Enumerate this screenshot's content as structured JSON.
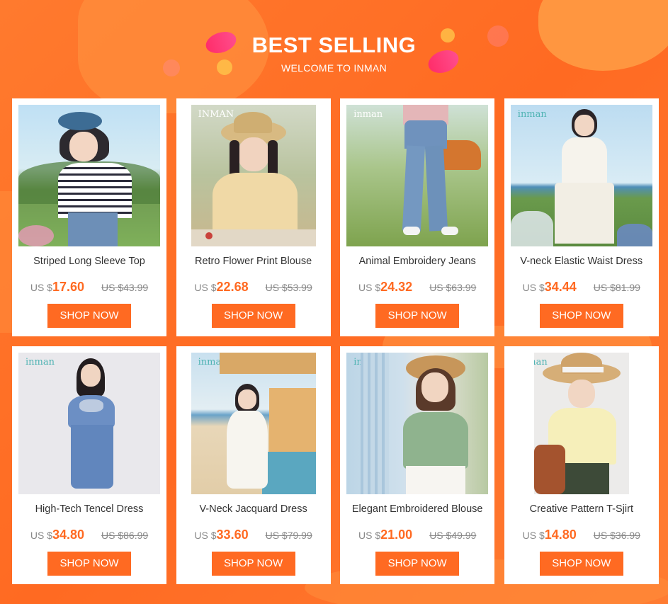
{
  "header": {
    "title": "BEST SELLING",
    "subtitle": "WELCOME TO INMAN"
  },
  "colors": {
    "accent": "#ff6a22",
    "background": "#ff7a2e"
  },
  "products": [
    {
      "name": "Striped Long Sleeve Top",
      "currency": "US $",
      "price": "17.60",
      "old_price": "US $43.99",
      "brand": "",
      "button": "SHOP NOW"
    },
    {
      "name": "Retro Flower Print Blouse",
      "currency": "US $",
      "price": "22.68",
      "old_price": "US $53.99",
      "brand": "INMAN",
      "button": "SHOP NOW"
    },
    {
      "name": "Animal Embroidery Jeans",
      "currency": "US $",
      "price": "24.32",
      "old_price": "US $63.99",
      "brand": "inman",
      "button": "SHOP NOW"
    },
    {
      "name": "V-neck Elastic Waist Dress",
      "currency": "US $",
      "price": "34.44",
      "old_price": "US $81.99",
      "brand": "inman",
      "button": "SHOP NOW"
    },
    {
      "name": "High-Tech Tencel Dress",
      "currency": "US $",
      "price": "34.80",
      "old_price": "US $86.99",
      "brand": "inman",
      "button": "SHOP NOW"
    },
    {
      "name": "V-Neck Jacquard Dress",
      "currency": "US $",
      "price": "33.60",
      "old_price": "US $79.99",
      "brand": "inman",
      "button": "SHOP NOW"
    },
    {
      "name": "Elegant Embroidered Blouse",
      "currency": "US $",
      "price": "21.00",
      "old_price": "US $49.99",
      "brand": "inman",
      "button": "SHOP NOW"
    },
    {
      "name": "Creative Pattern T-Sjirt",
      "currency": "US $",
      "price": "14.80",
      "old_price": "US $36.99",
      "brand": "inman",
      "button": "SHOP NOW"
    }
  ]
}
